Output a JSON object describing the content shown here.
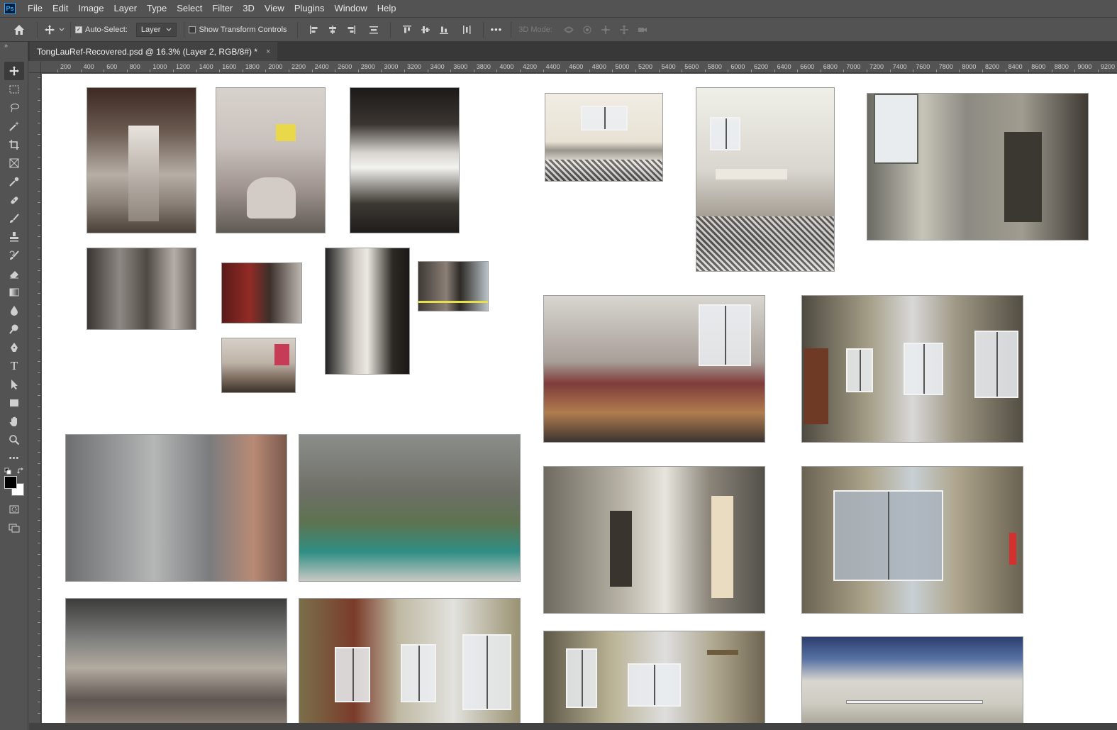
{
  "app": {
    "logo_text": "Ps"
  },
  "menu": [
    "File",
    "Edit",
    "Image",
    "Layer",
    "Type",
    "Select",
    "Filter",
    "3D",
    "View",
    "Plugins",
    "Window",
    "Help"
  ],
  "options": {
    "auto_select_label": "Auto-Select:",
    "auto_select_checked": true,
    "layer_select_value": "Layer",
    "show_transform_label": "Show Transform Controls",
    "show_transform_checked": false,
    "more_label": "•••",
    "mode_3d_label": "3D Mode:"
  },
  "document": {
    "tab_title": "TongLauRef-Recovered.psd @ 16.3% (Layer 2, RGB/8#) *",
    "close_glyph": "×"
  },
  "ruler_top_labels": [
    "200",
    "400",
    "600",
    "800",
    "1000",
    "1200",
    "1400",
    "1600",
    "1800",
    "2000",
    "2200",
    "2400",
    "2600",
    "2800",
    "3000",
    "3200",
    "3400",
    "3600",
    "3800",
    "4000",
    "4200",
    "4400",
    "4600",
    "4800",
    "5000",
    "5200",
    "5400",
    "5600",
    "5800",
    "6000",
    "6200",
    "6400",
    "6600",
    "6800",
    "7000",
    "7200",
    "7400",
    "7600",
    "7800",
    "8000",
    "8200",
    "8400",
    "8600",
    "8800",
    "9000",
    "9200"
  ],
  "toolbar": {
    "collapse_glyph": "»",
    "tools": [
      "move-tool",
      "marquee-tool",
      "lasso-tool",
      "magic-wand-tool",
      "crop-tool",
      "frame-tool",
      "eyedropper-tool",
      "healing-brush-tool",
      "brush-tool",
      "clone-stamp-tool",
      "history-brush-tool",
      "eraser-tool",
      "gradient-tool",
      "blur-tool",
      "dodge-tool",
      "pen-tool",
      "type-tool",
      "path-selection-tool",
      "rectangle-tool",
      "hand-tool",
      "zoom-tool",
      "more-tools"
    ],
    "type_tool_glyph": "T",
    "more_glyph": "•••",
    "foreground_color": "#000000",
    "background_color": "#ffffff"
  },
  "canvas": {
    "photos": [
      {
        "name": "photo-stairwell-entrance",
        "style": "ph-stair"
      },
      {
        "name": "photo-hallway-trash",
        "style": "ph-stair2"
      },
      {
        "name": "photo-stairwell-light",
        "style": "ph-stair3"
      },
      {
        "name": "photo-mailboxes",
        "style": "ph-mailbox"
      },
      {
        "name": "photo-red-stair",
        "style": "ph-red"
      },
      {
        "name": "photo-narrow-stair",
        "style": "ph-stair5"
      },
      {
        "name": "photo-alley",
        "style": "ph-alley"
      },
      {
        "name": "photo-stair-signs",
        "style": "ph-stair4"
      },
      {
        "name": "photo-empty-room-tiles",
        "style": "ph-room1"
      },
      {
        "name": "photo-kitchen-room",
        "style": "ph-room2"
      },
      {
        "name": "photo-cracked-room",
        "style": "ph-room3"
      },
      {
        "name": "photo-bunk-bed",
        "style": "ph-bunk"
      },
      {
        "name": "photo-windows-room",
        "style": "ph-room4"
      },
      {
        "name": "photo-building-facade",
        "style": "ph-facade"
      },
      {
        "name": "photo-courtyard-debris",
        "style": "ph-debris"
      },
      {
        "name": "photo-open-doors",
        "style": "ph-room5"
      },
      {
        "name": "photo-window-view",
        "style": "ph-room6"
      },
      {
        "name": "photo-rooftop",
        "style": "ph-rooftop"
      },
      {
        "name": "photo-red-door-room",
        "style": "ph-room7"
      },
      {
        "name": "photo-shelf-room",
        "style": "ph-room8"
      },
      {
        "name": "photo-peeling-wall",
        "style": "ph-wall"
      }
    ]
  }
}
